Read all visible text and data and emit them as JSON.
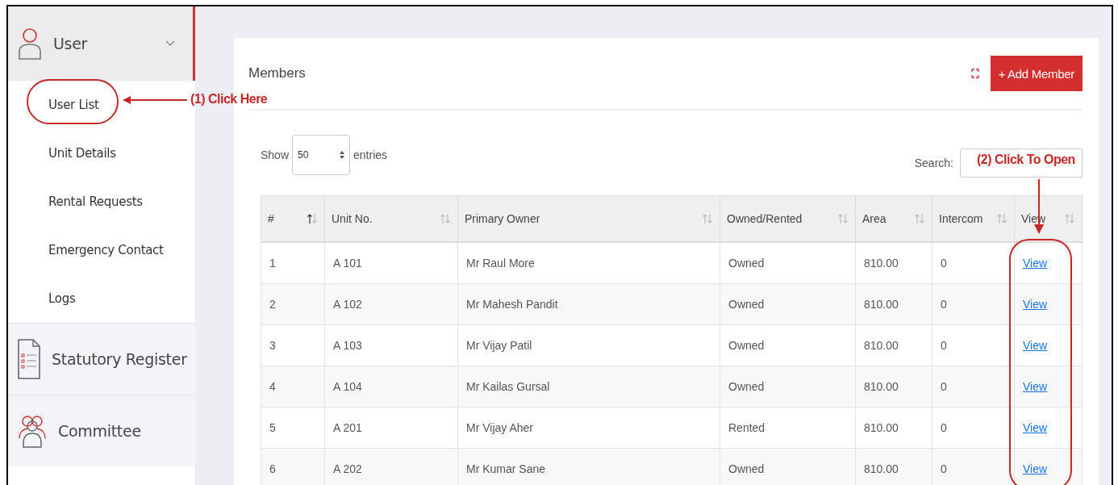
{
  "sidebar": {
    "sections": [
      {
        "label": "User",
        "kind": "user",
        "expanded": true,
        "children": [
          {
            "label": "User List"
          },
          {
            "label": "Unit Details"
          },
          {
            "label": "Rental Requests"
          },
          {
            "label": "Emergency Contact"
          },
          {
            "label": "Logs"
          }
        ]
      },
      {
        "label": "Statutory Register",
        "kind": "register"
      },
      {
        "label": "Committee",
        "kind": "group"
      }
    ]
  },
  "card": {
    "title": "Members",
    "add_button": "+ Add Member",
    "length": {
      "before": "Show",
      "value": "50",
      "after": "entries"
    },
    "search": {
      "label": "Search:"
    },
    "table": {
      "columns": [
        {
          "label": "#",
          "sorted": true
        },
        {
          "label": "Unit No.",
          "sorted": false
        },
        {
          "label": "Primary Owner",
          "sorted": false
        },
        {
          "label": "Owned/Rented",
          "sorted": false
        },
        {
          "label": "Area",
          "sorted": false
        },
        {
          "label": "Intercom",
          "sorted": false
        },
        {
          "label": "View",
          "sorted": false
        }
      ],
      "rows": [
        [
          "1",
          "A 101",
          "Mr Raul More",
          "Owned",
          "810.00",
          "0",
          "View"
        ],
        [
          "2",
          "A 102",
          "Mr Mahesh Pandit",
          "Owned",
          "810.00",
          "0",
          "View"
        ],
        [
          "3",
          "A 103",
          "Mr Vijay Patil",
          "Owned",
          "810.00",
          "0",
          "View"
        ],
        [
          "4",
          "A 104",
          "Mr Kailas Gursal",
          "Owned",
          "810.00",
          "0",
          "View"
        ],
        [
          "5",
          "A 201",
          "Mr Vijay Aher",
          "Rented",
          "810.00",
          "0",
          "View"
        ],
        [
          "6",
          "A 202",
          "Mr Kumar Sane",
          "Owned",
          "810.00",
          "0",
          "View"
        ]
      ]
    }
  },
  "annotations": [
    {
      "kind": "ellipse-arrow",
      "text": "(1) Click Here"
    },
    {
      "kind": "column-arrow",
      "text": "(2) Click To Open"
    }
  ]
}
